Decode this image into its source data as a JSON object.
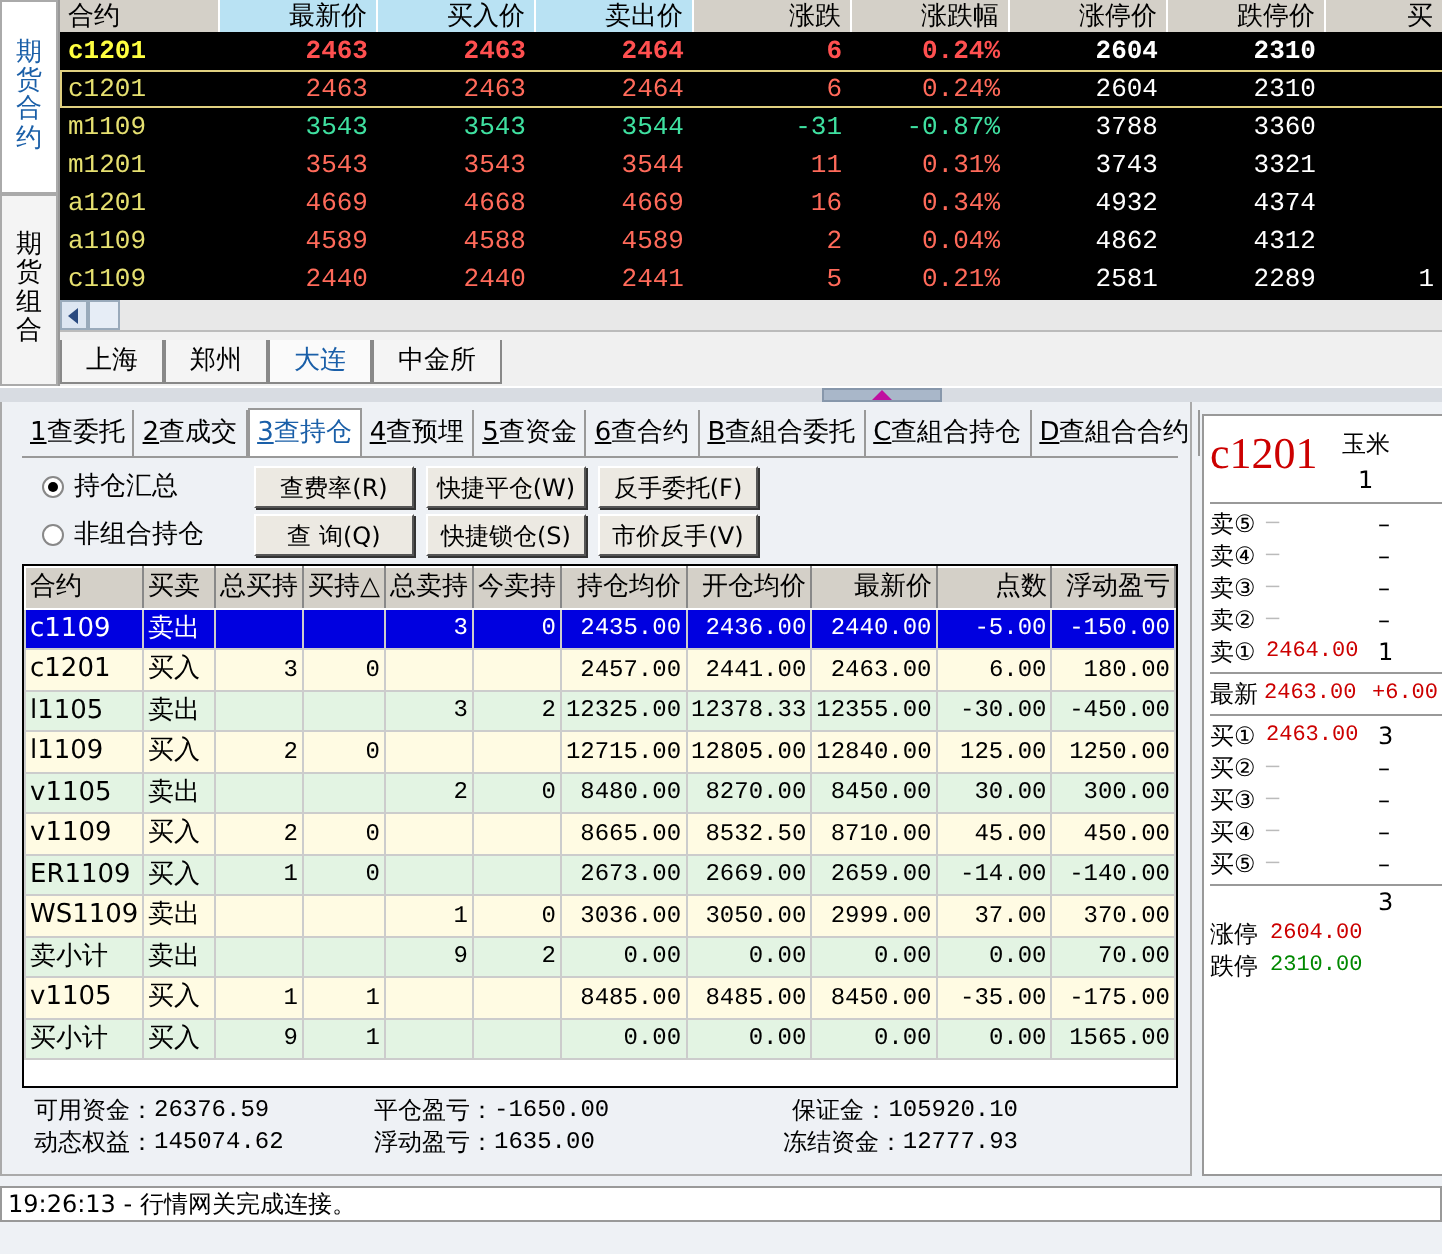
{
  "quote_board": {
    "side_tabs": [
      {
        "label": "期货合约",
        "selected": true
      },
      {
        "label": "期货组合",
        "selected": false
      }
    ],
    "columns": [
      {
        "label": "合约",
        "highlighted": false
      },
      {
        "label": "最新价",
        "highlighted": true
      },
      {
        "label": "买入价",
        "highlighted": true
      },
      {
        "label": "卖出价",
        "highlighted": true
      },
      {
        "label": "涨跌",
        "highlighted": false
      },
      {
        "label": "涨跌幅",
        "highlighted": false
      },
      {
        "label": "涨停价",
        "highlighted": false
      },
      {
        "label": "跌停价",
        "highlighted": false
      },
      {
        "label": "买",
        "highlighted": false
      }
    ],
    "rows": [
      {
        "contract": "c1201",
        "last": "2463",
        "bid": "2463",
        "ask": "2464",
        "change": "6",
        "change_pct": "0.24%",
        "limit_up": "2604",
        "limit_down": "2310",
        "color": "#ff5050",
        "emphasized": true,
        "selected": false
      },
      {
        "contract": "c1201",
        "last": "2463",
        "bid": "2463",
        "ask": "2464",
        "change": "6",
        "change_pct": "0.24%",
        "limit_up": "2604",
        "limit_down": "2310",
        "color": "#ff6a5a",
        "emphasized": false,
        "selected": true
      },
      {
        "contract": "m1109",
        "last": "3543",
        "bid": "3543",
        "ask": "3544",
        "change": "-31",
        "change_pct": "-0.87%",
        "limit_up": "3788",
        "limit_down": "3360",
        "color": "#3fe0a0",
        "emphasized": false,
        "selected": false
      },
      {
        "contract": "m1201",
        "last": "3543",
        "bid": "3543",
        "ask": "3544",
        "change": "11",
        "change_pct": "0.31%",
        "limit_up": "3743",
        "limit_down": "3321",
        "color": "#ff6a5a",
        "emphasized": false,
        "selected": false
      },
      {
        "contract": "a1201",
        "last": "4669",
        "bid": "4668",
        "ask": "4669",
        "change": "16",
        "change_pct": "0.34%",
        "limit_up": "4932",
        "limit_down": "4374",
        "color": "#ff6a5a",
        "emphasized": false,
        "selected": false
      },
      {
        "contract": "a1109",
        "last": "4589",
        "bid": "4588",
        "ask": "4589",
        "change": "2",
        "change_pct": "0.04%",
        "limit_up": "4862",
        "limit_down": "4312",
        "color": "#ff6a5a",
        "emphasized": false,
        "selected": false
      },
      {
        "contract": "c1109",
        "last": "2440",
        "bid": "2440",
        "ask": "2441",
        "change": "5",
        "change_pct": "0.21%",
        "limit_up": "2581",
        "limit_down": "2289",
        "column_9": "1",
        "color": "#ff6a5a",
        "emphasized": false,
        "selected": false
      }
    ],
    "exchange_tabs": [
      {
        "label": "上海",
        "selected": false
      },
      {
        "label": "郑州",
        "selected": false
      },
      {
        "label": "大连",
        "selected": true
      },
      {
        "label": "中金所",
        "selected": false
      }
    ]
  },
  "query_tabs": [
    {
      "key": "1",
      "label": "查委托",
      "selected": false
    },
    {
      "key": "2",
      "label": "查成交",
      "selected": false
    },
    {
      "key": "3",
      "label": "查持仓",
      "selected": true
    },
    {
      "key": "4",
      "label": "查预埋",
      "selected": false
    },
    {
      "key": "5",
      "label": "查资金",
      "selected": false
    },
    {
      "key": "6",
      "label": "查合约",
      "selected": false
    },
    {
      "key": "B",
      "label": "查組合委托",
      "selected": false
    },
    {
      "key": "C",
      "label": "查組合持仓",
      "selected": false
    },
    {
      "key": "D",
      "label": "查組合合约",
      "selected": false
    }
  ],
  "options": [
    {
      "label": "持仓汇总",
      "checked": true,
      "buttons": [
        "查费率(R)",
        "快捷平仓(W)",
        "反手委托(F)"
      ]
    },
    {
      "label": "非组合持仓",
      "checked": false,
      "buttons": [
        "查 询(Q)",
        "快捷锁仓(S)",
        "市价反手(V)"
      ]
    }
  ],
  "positions": {
    "columns": [
      {
        "label": "合约"
      },
      {
        "label": "买卖"
      },
      {
        "label": "总买持"
      },
      {
        "label": "买持",
        "sort_mark": "△"
      },
      {
        "label": "总卖持"
      },
      {
        "label": "今卖持"
      },
      {
        "label": "持仓均价"
      },
      {
        "label": "开仓均价"
      },
      {
        "label": "最新价"
      },
      {
        "label": "点数"
      },
      {
        "label": "浮动盈亏"
      }
    ],
    "rows": [
      {
        "contract": "c1109",
        "side": "卖出",
        "total_short": "3",
        "today_short": "0",
        "hold_avg": "2435.00",
        "open_avg": "2436.00",
        "last": "2440.00",
        "points": "-5.00",
        "float_pl": "-150.00",
        "selected": true
      },
      {
        "contract": "c1201",
        "side": "买入",
        "total_long": "3",
        "long": "0",
        "hold_avg": "2457.00",
        "open_avg": "2441.00",
        "last": "2463.00",
        "points": "6.00",
        "float_pl": "180.00",
        "selected": false
      },
      {
        "contract": "l1105",
        "side": "卖出",
        "total_short": "3",
        "today_short": "2",
        "hold_avg": "12325.00",
        "open_avg": "12378.33",
        "last": "12355.00",
        "points": "-30.00",
        "float_pl": "-450.00",
        "selected": false
      },
      {
        "contract": "l1109",
        "side": "买入",
        "total_long": "2",
        "long": "0",
        "hold_avg": "12715.00",
        "open_avg": "12805.00",
        "last": "12840.00",
        "points": "125.00",
        "float_pl": "1250.00",
        "selected": false
      },
      {
        "contract": "v1105",
        "side": "卖出",
        "total_short": "2",
        "today_short": "0",
        "hold_avg": "8480.00",
        "open_avg": "8270.00",
        "last": "8450.00",
        "points": "30.00",
        "float_pl": "300.00",
        "selected": false
      },
      {
        "contract": "v1109",
        "side": "买入",
        "total_long": "2",
        "long": "0",
        "hold_avg": "8665.00",
        "open_avg": "8532.50",
        "last": "8710.00",
        "points": "45.00",
        "float_pl": "450.00",
        "selected": false
      },
      {
        "contract": "ER1109",
        "side": "买入",
        "total_long": "1",
        "long": "0",
        "hold_avg": "2673.00",
        "open_avg": "2669.00",
        "last": "2659.00",
        "points": "-14.00",
        "float_pl": "-140.00",
        "selected": false
      },
      {
        "contract": "WS1109",
        "side": "卖出",
        "total_short": "1",
        "today_short": "0",
        "hold_avg": "3036.00",
        "open_avg": "3050.00",
        "last": "2999.00",
        "points": "37.00",
        "float_pl": "370.00",
        "selected": false
      },
      {
        "contract": "卖小计",
        "side": "卖出",
        "total_short": "9",
        "today_short": "2",
        "hold_avg": "0.00",
        "open_avg": "0.00",
        "last": "0.00",
        "points": "0.00",
        "float_pl": "70.00",
        "selected": false
      },
      {
        "contract": "v1105",
        "side": "买入",
        "total_long": "1",
        "long": "1",
        "hold_avg": "8485.00",
        "open_avg": "8485.00",
        "last": "8450.00",
        "points": "-35.00",
        "float_pl": "-175.00",
        "selected": false
      },
      {
        "contract": "买小计",
        "side": "买入",
        "total_long": "9",
        "long": "1",
        "hold_avg": "0.00",
        "open_avg": "0.00",
        "last": "0.00",
        "points": "0.00",
        "float_pl": "1565.00",
        "selected": false
      }
    ]
  },
  "summary": [
    {
      "label": "可用资金：",
      "value": "26376.59"
    },
    {
      "label": "平仓盈亏：",
      "value": "-1650.00"
    },
    {
      "label": "保证金：",
      "value": "105920.10"
    },
    {
      "label": "动态权益：",
      "value": "145074.62"
    },
    {
      "label": "浮动盈亏：",
      "value": "1635.00"
    },
    {
      "label": "冻结资金：",
      "value": "12777.93"
    }
  ],
  "quote_detail": {
    "contract": "c1201",
    "name": "玉米",
    "unit": "1",
    "asks": [
      {
        "label": "卖⑤",
        "price": "—",
        "volume": "–",
        "quoted": false
      },
      {
        "label": "卖④",
        "price": "—",
        "volume": "–",
        "quoted": false
      },
      {
        "label": "卖③",
        "price": "—",
        "volume": "–",
        "quoted": false
      },
      {
        "label": "卖②",
        "price": "—",
        "volume": "–",
        "quoted": false
      },
      {
        "label": "卖①",
        "price": "2464.00",
        "volume": "1",
        "quoted": true
      }
    ],
    "last": {
      "label": "最新",
      "price": "2463.00",
      "change": "+6.00"
    },
    "bids": [
      {
        "label": "买①",
        "price": "2463.00",
        "volume": "3",
        "quoted": true
      },
      {
        "label": "买②",
        "price": "—",
        "volume": "–",
        "quoted": false
      },
      {
        "label": "买③",
        "price": "—",
        "volume": "–",
        "quoted": false
      },
      {
        "label": "买④",
        "price": "—",
        "volume": "–",
        "quoted": false
      },
      {
        "label": "买⑤",
        "price": "—",
        "volume": "–",
        "quoted": false
      }
    ],
    "volume": "3",
    "limits": [
      {
        "label": "涨停",
        "price": "2604.00",
        "color": "#cc0000"
      },
      {
        "label": "跌停",
        "price": "2310.00",
        "color": "#008800"
      }
    ]
  },
  "status_bar": {
    "message": "19:26:13 - 行情网关完成连接。"
  }
}
